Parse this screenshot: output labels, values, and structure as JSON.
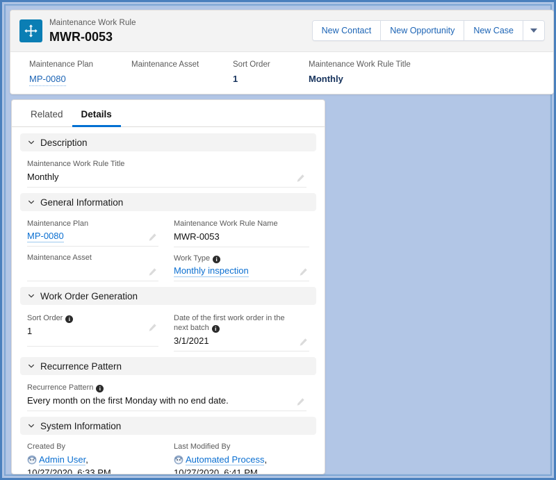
{
  "record_header": {
    "entity_type": "Maintenance Work Rule",
    "record_name": "MWR-0053",
    "icon": "four-way-arrow-icon",
    "actions": [
      {
        "label": "New Contact",
        "name": "new-contact-button"
      },
      {
        "label": "New Opportunity",
        "name": "new-opportunity-button"
      },
      {
        "label": "New Case",
        "name": "new-case-button"
      }
    ],
    "more_actions_icon": "chevron-down-icon",
    "compact_fields": [
      {
        "label": "Maintenance Plan",
        "value": "MP-0080",
        "is_link": true
      },
      {
        "label": "Maintenance Asset",
        "value": "",
        "is_link": false
      },
      {
        "label": "Sort Order",
        "value": "1",
        "is_link": false
      },
      {
        "label": "Maintenance Work Rule Title",
        "value": "Monthly",
        "is_link": false
      }
    ]
  },
  "tabs": [
    {
      "label": "Related",
      "active": false
    },
    {
      "label": "Details",
      "active": true
    }
  ],
  "sections": {
    "description": {
      "title": "Description",
      "fields": {
        "title": {
          "label": "Maintenance Work Rule Title",
          "value": "Monthly"
        }
      }
    },
    "general_information": {
      "title": "General Information",
      "fields": {
        "maintenance_plan": {
          "label": "Maintenance Plan",
          "value": "MP-0080"
        },
        "work_rule_name": {
          "label": "Maintenance Work Rule Name",
          "value": "MWR-0053"
        },
        "maintenance_asset": {
          "label": "Maintenance Asset",
          "value": ""
        },
        "work_type": {
          "label": "Work Type",
          "value": "Monthly inspection"
        }
      }
    },
    "work_order_generation": {
      "title": "Work Order Generation",
      "fields": {
        "sort_order": {
          "label": "Sort Order",
          "value": "1"
        },
        "first_work_order_date": {
          "label": "Date of the first work order in the next batch",
          "value": "3/1/2021"
        }
      }
    },
    "recurrence_pattern": {
      "title": "Recurrence Pattern",
      "fields": {
        "pattern": {
          "label": "Recurrence Pattern",
          "value": "Every month on the first Monday with no end date."
        }
      }
    },
    "system_information": {
      "title": "System Information",
      "fields": {
        "created_by": {
          "label": "Created By",
          "user": "Admin User",
          "separator": ",",
          "timestamp": "10/27/2020, 6:33 PM"
        },
        "last_modified_by": {
          "label": "Last Modified By",
          "user": "Automated Process",
          "separator": ",",
          "timestamp": "10/27/2020, 6:41 PM"
        }
      }
    }
  },
  "colors": {
    "brand_blue": "#0070d2",
    "link_blue": "#0b6fd1",
    "icon_blue": "#0b7eb4",
    "section_bg": "#f3f3f3",
    "page_bg": "#aec4e4"
  }
}
